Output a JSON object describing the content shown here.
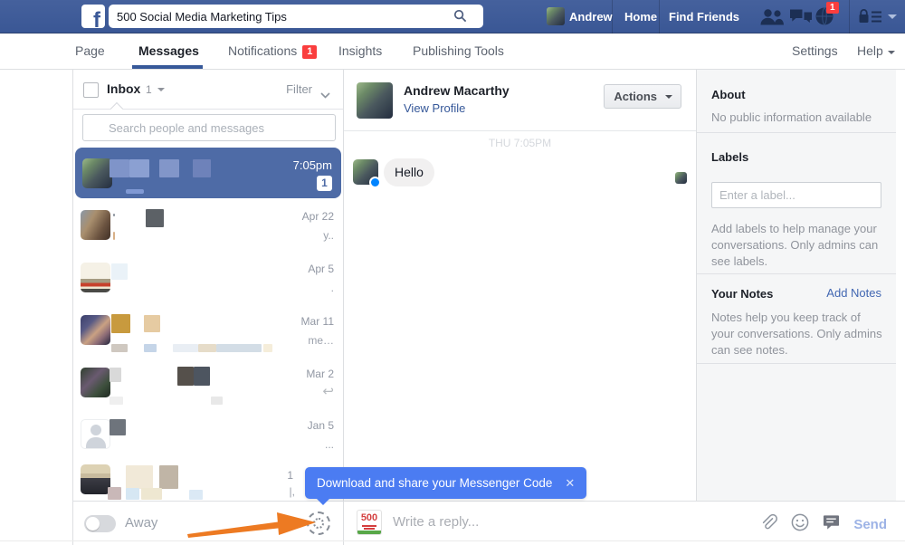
{
  "topbar": {
    "search_value": "500 Social Media Marketing Tips",
    "user_name": "Andrew",
    "home_label": "Home",
    "find_friends_label": "Find Friends",
    "notification_count": "1"
  },
  "nav": {
    "page": "Page",
    "messages": "Messages",
    "notifications": "Notifications",
    "notifications_badge": "1",
    "insights": "Insights",
    "publishing_tools": "Publishing Tools",
    "settings": "Settings",
    "help": "Help"
  },
  "inbox": {
    "title": "Inbox",
    "unread_count": "1",
    "filter_label": "Filter",
    "search_placeholder": "Search people and messages",
    "away_label": "Away",
    "conversations": [
      {
        "time": "7:05pm",
        "badge": "1"
      },
      {
        "date": "Apr 22",
        "snippet": "y.."
      },
      {
        "date": "Apr 5",
        "snippet": "."
      },
      {
        "date": "Mar 11",
        "snippet": "me…"
      },
      {
        "date": "Mar 2",
        "snippet": ""
      },
      {
        "date": "Jan 5",
        "snippet": "..."
      },
      {
        "date": "1",
        "snippet": "|,"
      }
    ]
  },
  "thread": {
    "name": "Andrew Macarthy",
    "view_profile": "View Profile",
    "actions_label": "Actions",
    "date_header": "THU 7:05PM",
    "message_text": "Hello"
  },
  "reply": {
    "logo_text": "500",
    "placeholder": "Write a reply...",
    "send_label": "Send"
  },
  "sidebar": {
    "about_title": "About",
    "about_text": "No public information available",
    "labels_title": "Labels",
    "label_placeholder": "Enter a label...",
    "labels_help": "Add labels to help manage your conversations. Only admins can see labels.",
    "notes_title": "Your Notes",
    "add_notes_label": "Add Notes",
    "notes_help": "Notes help you keep track of your conversations. Only admins can see notes."
  },
  "tooltip": {
    "text": "Download and share your Messenger Code",
    "close_label": "✕"
  },
  "colors": {
    "topbar_blue": "#3a5795",
    "selected_row_blue": "#4e6ba6",
    "tooltip_blue": "#4b7cf2",
    "badge_red": "#fa3e3e",
    "link_blue": "#365899",
    "annotation_orange": "#ed7a22"
  }
}
